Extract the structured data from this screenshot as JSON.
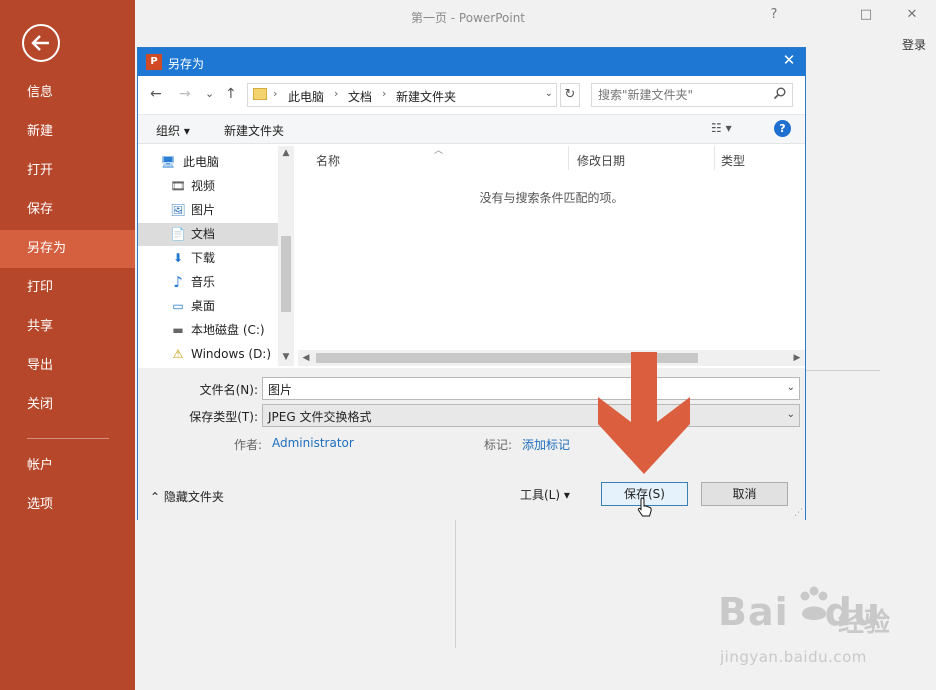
{
  "app": {
    "title": "第一页 - PowerPoint",
    "help": "?",
    "restore": "□",
    "close": "✕",
    "login": "登录"
  },
  "sidebar": {
    "items": [
      {
        "label": "信息"
      },
      {
        "label": "新建"
      },
      {
        "label": "打开"
      },
      {
        "label": "保存"
      },
      {
        "label": "另存为",
        "active": true
      },
      {
        "label": "打印"
      },
      {
        "label": "共享"
      },
      {
        "label": "导出"
      },
      {
        "label": "关闭"
      },
      {
        "label": "帐户"
      },
      {
        "label": "选项"
      }
    ]
  },
  "dialog": {
    "app_icon": "P",
    "title": "另存为",
    "close": "✕",
    "nav": {
      "back": "←",
      "forward": "→",
      "recent": "⌄",
      "up": "↑"
    },
    "breadcrumb": [
      "此电脑",
      "文档",
      "新建文件夹"
    ],
    "crumb_sep": "›",
    "refresh": "↻",
    "search_placeholder": "搜索\"新建文件夹\"",
    "toolbar": {
      "organize": "组织 ▾",
      "new_folder": "新建文件夹",
      "view": "☷ ▾",
      "help": "?"
    },
    "tree": [
      {
        "label": "此电脑",
        "icon": "computer-icon",
        "glyph": "🖥"
      },
      {
        "label": "视频",
        "icon": "video-icon",
        "glyph": "🎞"
      },
      {
        "label": "图片",
        "icon": "pictures-icon",
        "glyph": "🖼"
      },
      {
        "label": "文档",
        "icon": "documents-icon",
        "glyph": "📄",
        "selected": true
      },
      {
        "label": "下载",
        "icon": "download-icon",
        "glyph": "⬇"
      },
      {
        "label": "音乐",
        "icon": "music-icon",
        "glyph": "♪"
      },
      {
        "label": "桌面",
        "icon": "desktop-icon",
        "glyph": "▭"
      },
      {
        "label": "本地磁盘 (C:)",
        "icon": "local-disk-icon",
        "glyph": "▬"
      },
      {
        "label": "Windows (D:)",
        "icon": "drive-warning-icon",
        "glyph": "⚠"
      }
    ],
    "columns": {
      "name": "名称",
      "modified": "修改日期",
      "type": "类型"
    },
    "empty_message": "没有与搜索条件匹配的项。",
    "form": {
      "filename_label": "文件名(N):",
      "filename_value": "图片",
      "filetype_label": "保存类型(T):",
      "filetype_value": "JPEG 文件交换格式",
      "author_label": "作者:",
      "author_value": "Administrator",
      "tags_label": "标记:",
      "tags_value": "添加标记"
    },
    "hide_folders": "⌃ 隐藏文件夹",
    "tools": "工具(L)     ▾",
    "save": "保存(S)",
    "cancel": "取消"
  },
  "annotation_color": "#db5f3e",
  "watermark": {
    "logo": "Bai",
    "logo_tail": "du",
    "cn": "经验",
    "url": "jingyan.baidu.com"
  }
}
